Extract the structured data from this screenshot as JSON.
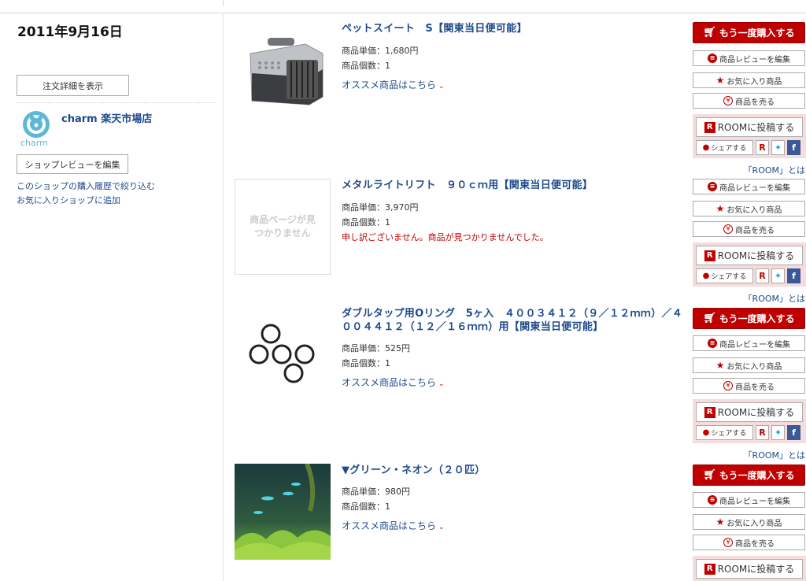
{
  "order": {
    "date": "2011年9月16日",
    "detail_button": "注文詳細を表示"
  },
  "shop": {
    "name": "charm 楽天市場店",
    "logo_text": "charm",
    "review_button": "ショップレビューを編集",
    "history_link": "このショップの購入履歴で絞り込む",
    "favorite_link": "お気に入りショップに追加"
  },
  "labels": {
    "unit_price": "商品単価：",
    "quantity": "商品個数：",
    "recommend": "オススメ商品はこちら",
    "rebuy": "もう一度購入する",
    "review": "商品レビューを編集",
    "favorite": "お気に入り商品",
    "sell": "商品を売る",
    "room_post": "ROOMに投稿する",
    "share": "シェアする",
    "room_about": "「ROOM」とは",
    "not_found_image": "商品ページが見つかりません",
    "not_found_msg": "申し訳ございません。商品が見つかりませんでした。"
  },
  "items": [
    {
      "name": "ペットスイート　S【関東当日便可能】",
      "price": "1,680円",
      "qty": "1"
    },
    {
      "name": "メタルライトリフト　９０ｃｍ用【関東当日便可能】",
      "price": "3,970円",
      "qty": "1"
    },
    {
      "name": "ダブルタップ用Oリング　5ヶ入　４００３４１２（９／１２ｍｍ）／４００４４１２（１２／１６ｍｍ）用【関東当日便可能】",
      "price": "525円",
      "qty": "1"
    },
    {
      "name": "▼グリーン・ネオン（２０匹）",
      "price": "980円",
      "qty": "1"
    }
  ],
  "colors": {
    "accent": "#bf0000",
    "link": "#1d4a8c",
    "room_bg": "#f6dcdc"
  },
  "icons": [
    "cart-icon",
    "review-icon",
    "star-icon",
    "yen-icon",
    "room-icon",
    "share-icon",
    "rakuten-icon",
    "twitter-icon",
    "facebook-icon",
    "chevron-down-icon"
  ]
}
